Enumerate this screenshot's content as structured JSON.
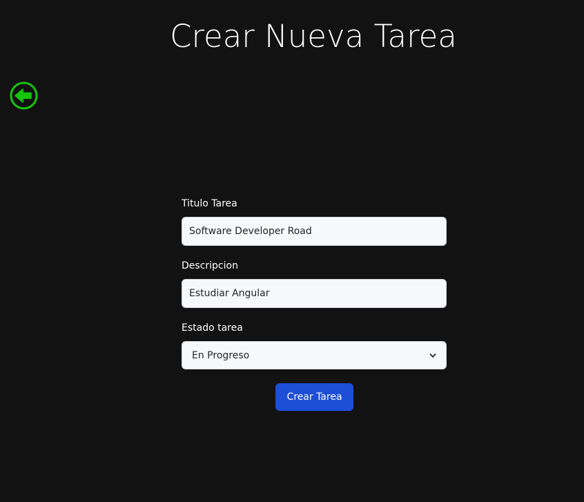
{
  "header": {
    "title": "Crear Nueva Tarea"
  },
  "nav": {
    "back_icon": "arrow-left-circle-icon",
    "accent_color": "#16c60c"
  },
  "form": {
    "title_label": "Titulo Tarea",
    "title_value": "Software Developer Road",
    "description_label": "Descripcion",
    "description_value": "Estudiar Angular",
    "status_label": "Estado tarea",
    "status_value": "En Progreso",
    "submit_label": "Crear Tarea",
    "button_color": "#1d4ed8"
  }
}
